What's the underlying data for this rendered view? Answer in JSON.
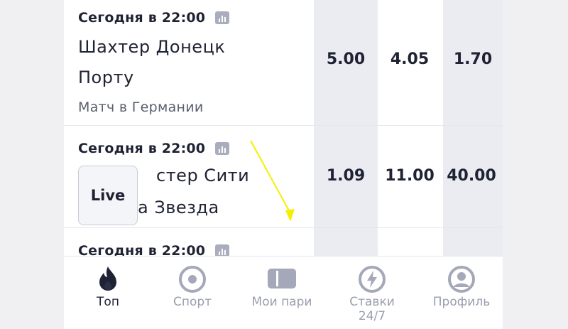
{
  "matches": [
    {
      "time": "Сегодня в 22:00",
      "team1": "Шахтер Донецк",
      "team2": "Порту",
      "note": "Матч в Германии",
      "odds": [
        "5.00",
        "4.05",
        "1.70"
      ]
    },
    {
      "time": "Сегодня в 22:00",
      "team1_partial": "стер Сити",
      "team2_partial": "а Звезда",
      "odds": [
        "1.09",
        "11.00",
        "40.00"
      ],
      "live_badge": "Live"
    },
    {
      "time": "Сегодня в 22:00"
    }
  ],
  "nav": [
    {
      "label": "Топ",
      "icon": "flame-icon",
      "active": true
    },
    {
      "label": "Спорт",
      "icon": "ball-icon",
      "active": false
    },
    {
      "label": "Мои пари",
      "icon": "ticket-icon",
      "active": false
    },
    {
      "label": "Ставки\n24/7",
      "icon": "lightning-icon",
      "active": false
    },
    {
      "label": "Профиль",
      "icon": "profile-icon",
      "active": false
    }
  ],
  "colors": {
    "accent": "#1f2233",
    "inactive": "#9a9eae",
    "odds_bg": "#eaecf2",
    "arrow": "#f5f000"
  }
}
